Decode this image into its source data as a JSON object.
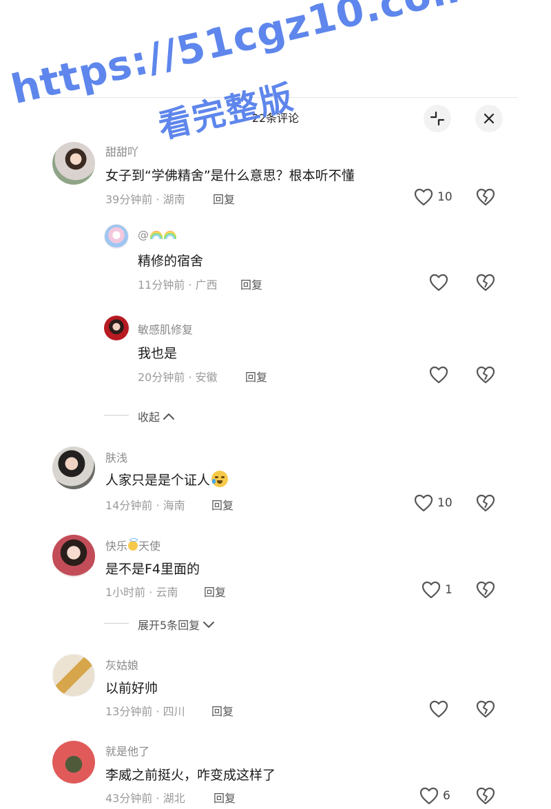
{
  "watermark": {
    "url": "https://51cgz10.com",
    "subtitle": "看完整版"
  },
  "header": {
    "title": "22条评论"
  },
  "comments": [
    {
      "name": "甜甜吖",
      "text": "女子到“学佛精舍”是什么意思？根本听不懂",
      "time": "39分钟前 · 湖南",
      "reply": "回复",
      "likes": "10"
    },
    {
      "name": "@",
      "text": "精修的宿舍",
      "time": "11分钟前 · 广西",
      "reply": "回复",
      "likes": ""
    },
    {
      "name": "敏感肌修复",
      "text": "我也是",
      "time": "20分钟前 · 安徽",
      "reply": "回复",
      "likes": ""
    },
    {
      "name": "肤浅",
      "text": "人家只是是个证人",
      "time": "14分钟前 · 海南",
      "reply": "回复",
      "likes": "10"
    },
    {
      "name_a": "快乐",
      "name_b": "天使",
      "text": "是不是F4里面的",
      "time": "1小时前 · 云南",
      "reply": "回复",
      "likes": "1"
    },
    {
      "name": "灰姑娘",
      "text": "以前好帅",
      "time": "13分钟前 · 四川",
      "reply": "回复",
      "likes": ""
    },
    {
      "name": "就是他了",
      "text": "李威之前挺火，咋变成这样了",
      "time": "43分钟前 · 湖北",
      "reply": "回复",
      "likes": "6"
    }
  ],
  "folds": {
    "collapse": "收起",
    "expand": "展开5条回复"
  },
  "icons": {
    "collapse": "collapse-icon",
    "close": "close-icon",
    "like": "heart-outline-icon",
    "dislike": "broken-heart-icon",
    "chevron_up": "chevron-up-icon",
    "chevron_down": "chevron-down-icon"
  }
}
